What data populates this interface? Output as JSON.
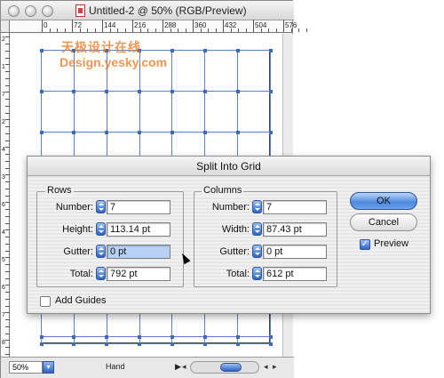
{
  "window": {
    "title": "Untitled-2 @ 50% (RGB/Preview)",
    "watermark_cn": "天极设计在线",
    "watermark_url": "Design.yesky.com"
  },
  "ruler_top": [
    "0",
    "72",
    "144",
    "216",
    "288",
    "360",
    "432",
    "504",
    "576"
  ],
  "ruler_left": [
    "2",
    "1",
    "7",
    "2",
    "4",
    "3",
    "6",
    "4",
    "5",
    "6",
    "7",
    "8"
  ],
  "statusbar": {
    "zoom": "50%",
    "tool": "Hand"
  },
  "dialog": {
    "title": "Split Into Grid",
    "rows": {
      "label": "Rows",
      "number_label": "Number:",
      "number": "7",
      "height_label": "Height:",
      "height": "113.14 pt",
      "gutter_label": "Gutter:",
      "gutter": "0 pt",
      "total_label": "Total:",
      "total": "792 pt"
    },
    "columns": {
      "label": "Columns",
      "number_label": "Number:",
      "number": "7",
      "width_label": "Width:",
      "width": "87.43 pt",
      "gutter_label": "Gutter:",
      "gutter": "0 pt",
      "total_label": "Total:",
      "total": "612 pt"
    },
    "ok_label": "OK",
    "cancel_label": "Cancel",
    "preview_label": "Preview",
    "preview_checked": true,
    "add_guides_label": "Add Guides",
    "add_guides_checked": false
  }
}
